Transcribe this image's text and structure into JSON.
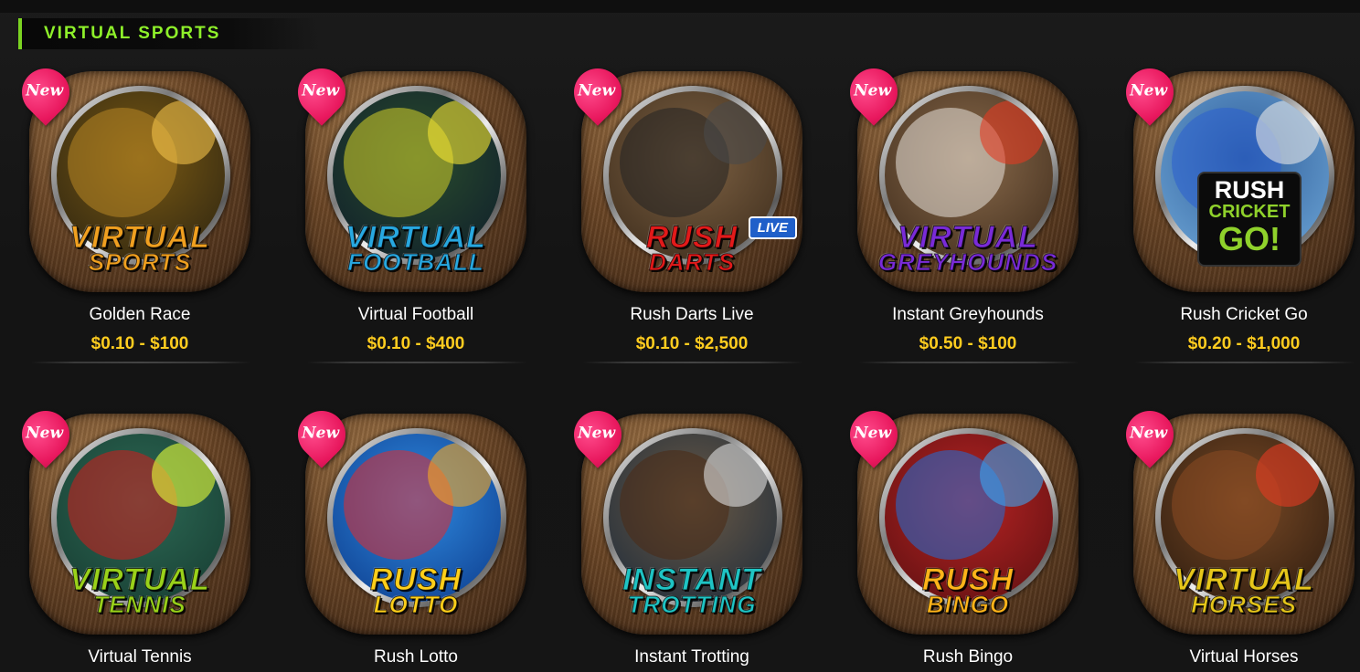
{
  "section": {
    "title": "VIRTUAL SPORTS"
  },
  "badge_label": "New",
  "games": [
    {
      "name": "Golden Race",
      "range": "$0.10 - $100",
      "logo_line1": "VIRTUAL",
      "logo_line2": "SPORTS",
      "logo_color": "#f0a020",
      "art_from": "#2a2210",
      "art_to": "#7a5a14",
      "deco1": "#b88624",
      "deco2": "#f2c14a",
      "icon": "horse-greyhound-icon"
    },
    {
      "name": "Virtual Football",
      "range": "$0.10 - $400",
      "logo_line1": "VIRTUAL",
      "logo_line2": "FOOTBALL",
      "logo_color": "#28a8e0",
      "art_from": "#0e1c2a",
      "art_to": "#2a4d2e",
      "deco1": "#d6d22a",
      "deco2": "#f3e533",
      "icon": "football-player-icon"
    },
    {
      "name": "Rush Darts Live",
      "range": "$0.10 - $2,500",
      "logo_line1": "RUSH",
      "logo_line2": "DARTS",
      "logo_color": "#e21a1a",
      "art_from": "#3a2a1a",
      "art_to": "#7e6244",
      "deco1": "#222222",
      "deco2": "#4a4a4a",
      "icon": "darts-icon",
      "live_label": "LIVE"
    },
    {
      "name": "Instant Greyhounds",
      "range": "$0.50 - $100",
      "logo_line1": "VIRTUAL",
      "logo_line2": "GREYHOUNDS",
      "logo_color": "#7a2bd8",
      "art_from": "#3d2a1a",
      "art_to": "#8a6b4c",
      "deco1": "#e8e2da",
      "deco2": "#e23a22",
      "icon": "greyhound-icon"
    },
    {
      "name": "Rush Cricket Go",
      "range": "$0.20 - $1,000",
      "logo_line1": "RUSH",
      "logo_line2": "CRICKET",
      "logo_line3": "GO!",
      "logo_color": "#ffffff",
      "art_from": "#6fa8d8",
      "art_to": "#2f5d9a",
      "deco1": "#2a5fd0",
      "deco2": "#e6e6e6",
      "icon": "cricket-player-icon"
    },
    {
      "name": "Virtual Tennis",
      "range": "",
      "logo_line1": "VIRTUAL",
      "logo_line2": "TENNIS",
      "logo_color": "#9ad21a",
      "art_from": "#163a30",
      "art_to": "#2d6a55",
      "deco1": "#d41c1c",
      "deco2": "#e8ff3a",
      "icon": "tennis-player-icon"
    },
    {
      "name": "Rush Lotto",
      "range": "",
      "logo_line1": "RUSH",
      "logo_line2": "LOTTO",
      "logo_color": "#ffcf1a",
      "art_from": "#0c3a8a",
      "art_to": "#2f8ae0",
      "deco1": "#e22c2c",
      "deco2": "#f5a623",
      "icon": "lotto-balls-icon"
    },
    {
      "name": "Instant Trotting",
      "range": "",
      "logo_line1": "INSTANT",
      "logo_line2": "TROTTING",
      "logo_color": "#1fc4c4",
      "art_from": "#1b2a3a",
      "art_to": "#6b5a46",
      "deco1": "#4a2a14",
      "deco2": "#dedede",
      "icon": "trotting-horse-icon"
    },
    {
      "name": "Rush Bingo",
      "range": "",
      "logo_line1": "RUSH",
      "logo_line2": "BINGO",
      "logo_color": "#ffb41a",
      "art_from": "#5a0f10",
      "art_to": "#b82424",
      "deco1": "#1f6fd8",
      "deco2": "#3aa3f0",
      "icon": "bingo-balls-icon"
    },
    {
      "name": "Virtual Horses",
      "range": "",
      "logo_line1": "VIRTUAL",
      "logo_line2": "HORSES",
      "logo_color": "#e6c61a",
      "art_from": "#2a1a0e",
      "art_to": "#7a4a26",
      "deco1": "#8a4a22",
      "deco2": "#e23a22",
      "icon": "racehorse-jockey-icon"
    }
  ]
}
